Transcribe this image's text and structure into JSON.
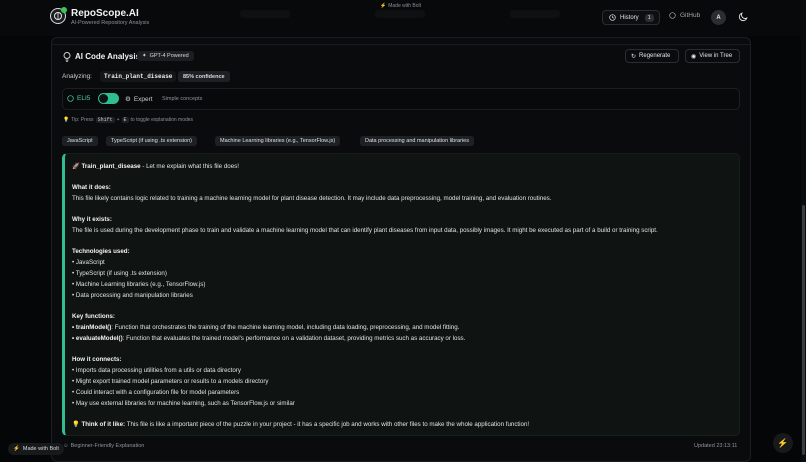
{
  "top_badge": "Made with Bolt",
  "brand": {
    "title": "RepoScope.AI",
    "subtitle": "AI-Powered Repository Analysis"
  },
  "header": {
    "history_label": "History",
    "history_count": "1",
    "github_label": "GitHub",
    "avatar_initial": "A"
  },
  "analysis": {
    "title": "AI Code Analysis",
    "model_badge": "GPT-4 Powered",
    "regenerate_label": "Regenerate",
    "view_tree_label": "View in Tree",
    "analyzing_label": "Analyzing:",
    "file_name": "Train_plant_disease",
    "confidence": "85% confidence"
  },
  "mode": {
    "eli5_label": "ELI5",
    "expert_label": "Expert",
    "description": "Simple concepts",
    "tip_prefix": "Tip: Press",
    "tip_key_shift": "Shift",
    "tip_plus": "+",
    "tip_key_e": "E",
    "tip_suffix": "to toggle explanation modes"
  },
  "tags": [
    "JavaScript",
    "TypeScript (if using .ts extension)",
    "Machine Learning libraries (e.g., TensorFlow.js)",
    "Data processing and manipulation libraries"
  ],
  "explanation": {
    "intro_file": "Train_plant_disease",
    "intro_rest": " - Let me explain what this file does!",
    "what_head": "What it does:",
    "what_text": "This file likely contains logic related to training a machine learning model for plant disease detection. It may include data preprocessing, model training, and evaluation routines.",
    "why_head": "Why it exists:",
    "why_text": "The file is used during the development phase to train and validate a machine learning model that can identify plant diseases from input data, possibly images. It might be executed as part of a build or training script.",
    "tech_head": "Technologies used:",
    "tech_items": [
      "• JavaScript",
      "• TypeScript (if using .ts extension)",
      "• Machine Learning libraries (e.g., TensorFlow.js)",
      "• Data processing and manipulation libraries"
    ],
    "func_head": "Key functions:",
    "func_items": [
      {
        "name": "• trainModel()",
        "desc": ": Function that orchestrates the training of the machine learning model, including data loading, preprocessing, and model fitting."
      },
      {
        "name": "• evaluateModel()",
        "desc": ": Function that evaluates the trained model's performance on a validation dataset, providing metrics such as accuracy or loss."
      }
    ],
    "connect_head": "How it connects:",
    "connect_items": [
      "• Imports data processing utilities from a utils or data directory",
      "• Might export trained model parameters or results to a models directory",
      "• Could interact with a configuration file for model parameters",
      "• May use external libraries for machine learning, such as TensorFlow.js or similar"
    ],
    "think_head": "Think of it like:",
    "think_text": " This file is like a important piece of the puzzle in your project - it has a specific job and works with other files to make the whole application function!"
  },
  "footer": {
    "left": "Beginner-Friendly Explanation",
    "right": "Updated 23:13:11"
  },
  "bolt_badge": "Made with Bolt",
  "colors": {
    "accent": "#2fbf8f",
    "background": "#050607",
    "panel": "#0a0b0c"
  }
}
